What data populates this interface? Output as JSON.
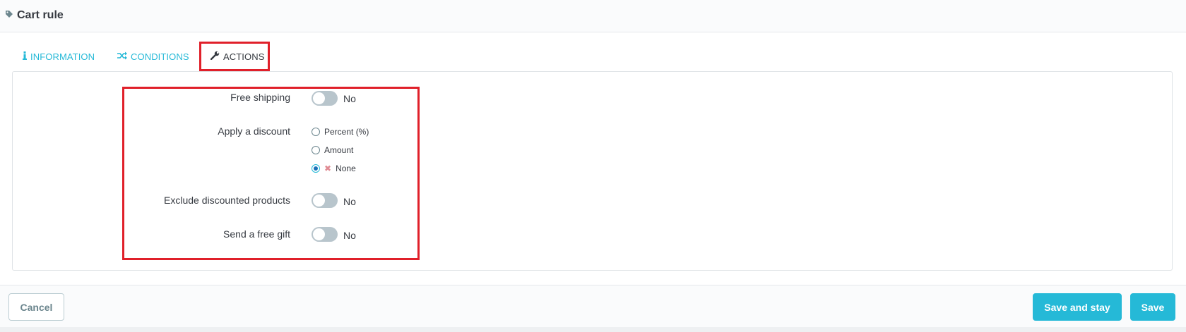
{
  "header": {
    "title": "Cart rule",
    "icon": "tag-icon"
  },
  "tabs": [
    {
      "label": "INFORMATION",
      "icon": "info-icon",
      "active": false
    },
    {
      "label": "CONDITIONS",
      "icon": "shuffle-icon",
      "active": false
    },
    {
      "label": "ACTIONS",
      "icon": "wrench-icon",
      "active": true
    }
  ],
  "form": {
    "free_shipping": {
      "label": "Free shipping",
      "state": "No"
    },
    "apply_discount": {
      "label": "Apply a discount",
      "options": [
        {
          "label": "Percent (%)",
          "checked": false
        },
        {
          "label": "Amount",
          "checked": false
        },
        {
          "label": "None",
          "checked": true
        }
      ]
    },
    "exclude_discounted": {
      "label": "Exclude discounted products",
      "state": "No"
    },
    "free_gift": {
      "label": "Send a free gift",
      "state": "No"
    }
  },
  "footer": {
    "cancel_label": "Cancel",
    "save_stay_label": "Save and stay",
    "save_label": "Save"
  },
  "colors": {
    "accent": "#25b9d7",
    "highlight": "#e0202a",
    "text": "#363a41"
  }
}
